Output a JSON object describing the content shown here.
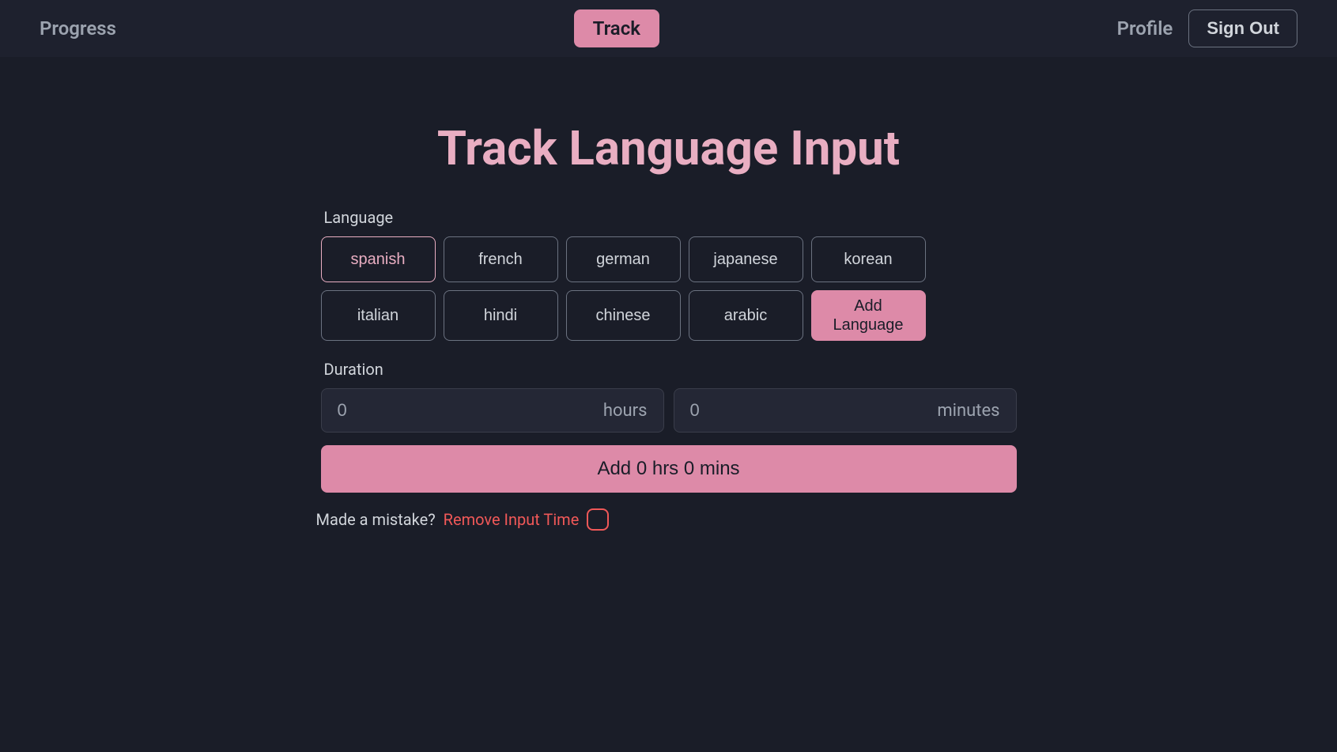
{
  "nav": {
    "progress": "Progress",
    "track": "Track",
    "profile": "Profile",
    "signOut": "Sign Out"
  },
  "page": {
    "title": "Track Language Input"
  },
  "labels": {
    "language": "Language",
    "duration": "Duration"
  },
  "languages": [
    "spanish",
    "french",
    "german",
    "japanese",
    "korean",
    "italian",
    "hindi",
    "chinese",
    "arabic"
  ],
  "selectedLanguage": "spanish",
  "addLanguage": "Add Language",
  "duration": {
    "hoursValue": "0",
    "hoursUnit": "hours",
    "minutesValue": "0",
    "minutesUnit": "minutes"
  },
  "submit": "Add 0 hrs 0 mins",
  "mistake": {
    "prompt": "Made a mistake?",
    "removeLink": "Remove Input Time"
  }
}
